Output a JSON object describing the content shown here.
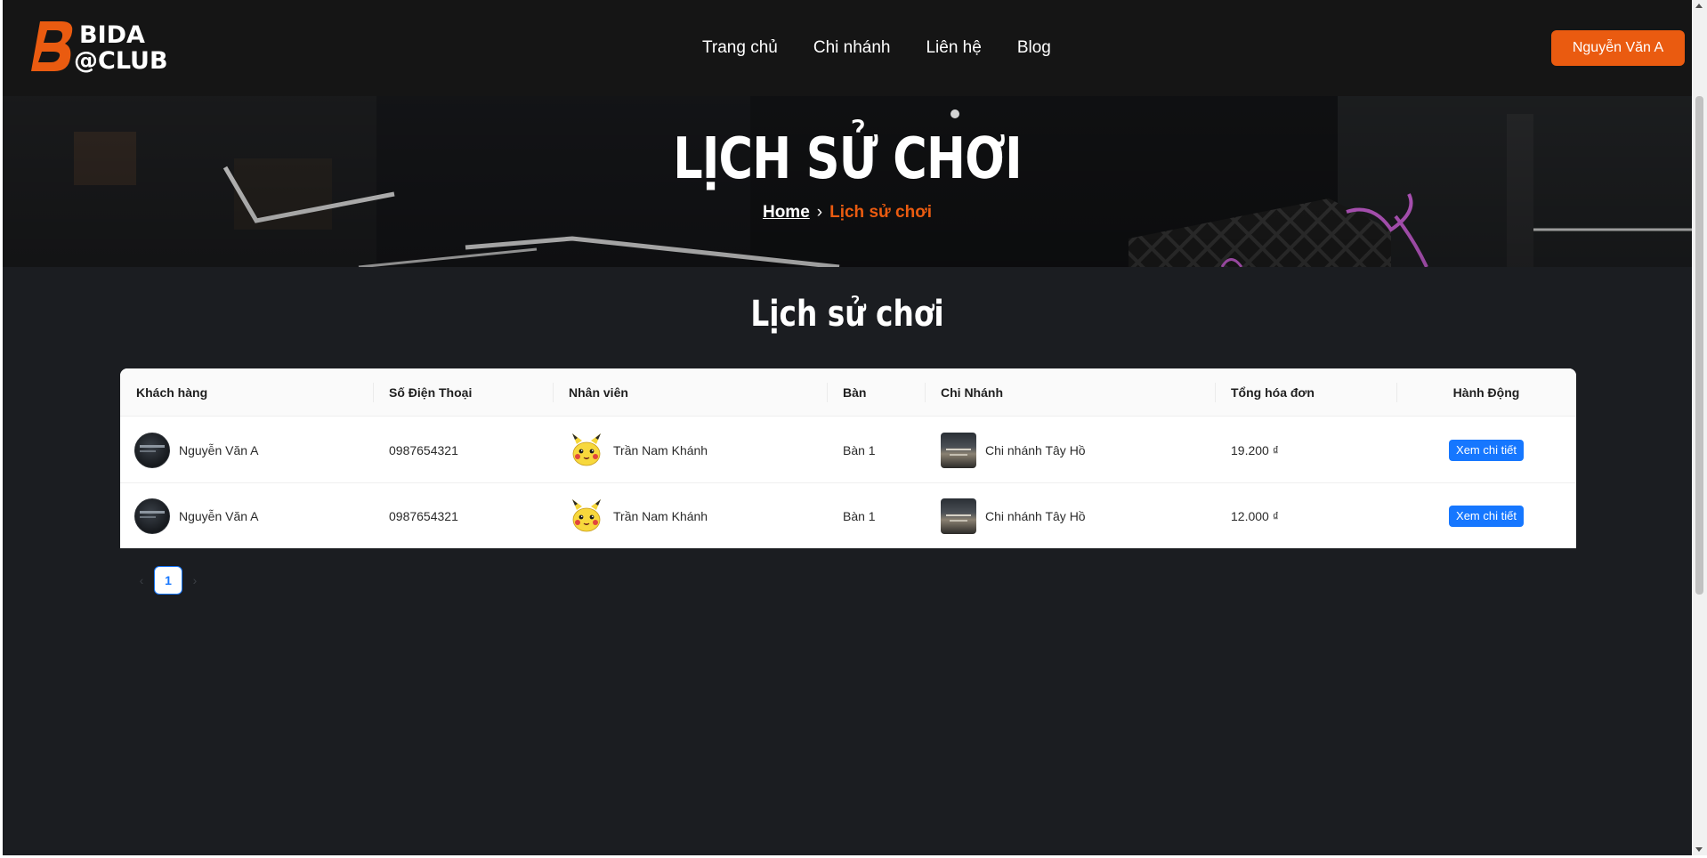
{
  "header": {
    "logo": {
      "line1": "BIDA",
      "line2": "@CLUB"
    },
    "nav": [
      {
        "label": "Trang chủ"
      },
      {
        "label": "Chi nhánh"
      },
      {
        "label": "Liên hệ"
      },
      {
        "label": "Blog"
      }
    ],
    "user_button": "Nguyễn Văn A"
  },
  "hero": {
    "title": "LỊCH SỬ CHƠI",
    "breadcrumb": {
      "home": "Home",
      "separator": "›",
      "current": "Lịch sử chơi"
    }
  },
  "main": {
    "section_title": "Lịch sử chơi",
    "table": {
      "columns": [
        "Khách hàng",
        "Số Điện Thoại",
        "Nhân viên",
        "Bàn",
        "Chi Nhánh",
        "Tổng hóa đơn",
        "Hành Động"
      ],
      "rows": [
        {
          "customer": "Nguyễn Văn A",
          "phone": "0987654321",
          "staff": "Trần Nam Khánh",
          "table": "Bàn 1",
          "branch": "Chi nhánh Tây Hồ",
          "total": "19.200 ₫",
          "action": "Xem chi tiết"
        },
        {
          "customer": "Nguyễn Văn A",
          "phone": "0987654321",
          "staff": "Trần Nam Khánh",
          "table": "Bàn 1",
          "branch": "Chi nhánh Tây Hồ",
          "total": "12.000 ₫",
          "action": "Xem chi tiết"
        }
      ]
    },
    "pagination": {
      "prev": "‹",
      "current_page": "1",
      "next": "›"
    }
  },
  "colors": {
    "accent": "#ea5b10",
    "primary_button": "#1677ff",
    "page_background": "#1b1d21",
    "header_background": "#151515"
  }
}
